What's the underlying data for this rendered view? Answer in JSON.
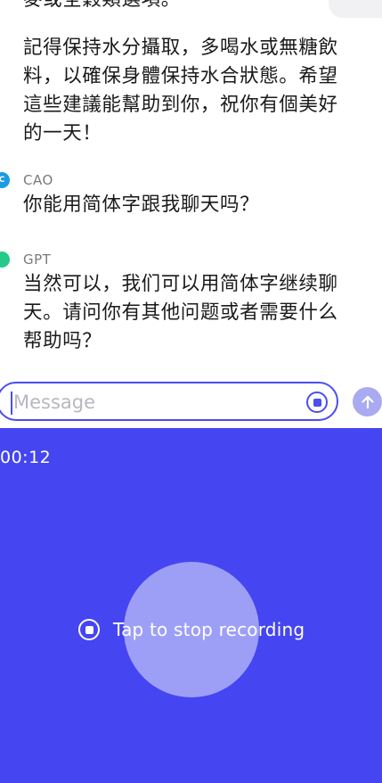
{
  "conversation": {
    "previous_fragment": "麥或全穀類選項。",
    "assistant_paragraph": [
      "記得保持水分攝取，多喝水或無糖飲",
      "料，以確保身體保持水合狀態。希望",
      "這些建議能幫助到你，祝你有個美好",
      "的一天！"
    ],
    "messages": [
      {
        "sender": "CAO",
        "avatar_letter": "C",
        "avatar_color": "#1b9be0",
        "lines": [
          "你能用简体字跟我聊天吗？"
        ]
      },
      {
        "sender": "GPT",
        "avatar_letter": "",
        "avatar_color": "#26c98a",
        "lines": [
          "当然可以，我们可以用简体字继续聊",
          "天。请问你有其他问题或者需要什么",
          "帮助吗？"
        ]
      }
    ]
  },
  "composer": {
    "placeholder": "Message",
    "accent_color": "#4a4ef0",
    "record_icon": "stop-circle-icon",
    "send_icon": "arrow-up-icon"
  },
  "recording": {
    "timer": "00:12",
    "stop_label": "Tap to stop recording",
    "stop_icon": "stop-circle-icon",
    "panel_color": "#4545f2"
  }
}
